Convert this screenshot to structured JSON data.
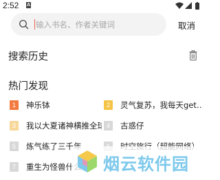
{
  "status_bar": {
    "time": "2:52",
    "notification_icon": "A",
    "icons": [
      "wifi-icon",
      "signal-icon",
      "battery-icon"
    ]
  },
  "search": {
    "placeholder": "输入书名、作者关键词",
    "value": "",
    "cancel_label": "取消"
  },
  "history": {
    "title": "搜索历史",
    "clear_icon": "trash-icon"
  },
  "hot": {
    "title": "热门发现",
    "items": [
      {
        "rank": "1",
        "title": "神乐钵",
        "badge_color": "#f37b3f"
      },
      {
        "rank": "2",
        "title": "灵气复苏，我每天get…",
        "badge_color": "#f5c346"
      },
      {
        "rank": "3",
        "title": "我以大夏诸神横推全球",
        "badge_color": "#f8d89a"
      },
      {
        "rank": "4",
        "title": "古惑仔",
        "badge_color": "#d8d8d8"
      },
      {
        "rank": "5",
        "title": "炼气练了三千年",
        "badge_color": "#d8d8d8"
      },
      {
        "rank": "6",
        "title": "时空旅行（超能网络）",
        "badge_color": "#d8d8d8"
      },
      {
        "rank": "7",
        "title": "重生为怪兽什么鬼",
        "badge_color": "#d8d8d8"
      }
    ]
  },
  "watermark": {
    "text": "烟云软件园"
  },
  "colors": {
    "accent": "#e8614d",
    "search_bg": "#f3f3f3",
    "watermark": "#7ec9ec"
  }
}
